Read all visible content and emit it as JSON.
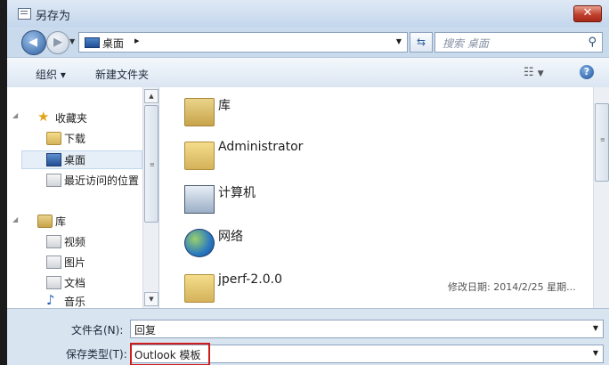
{
  "window": {
    "title": "另存为",
    "close_label": "✕"
  },
  "nav": {
    "address_segment": "桌面",
    "address_separator": "▸",
    "search_placeholder": "搜索 桌面"
  },
  "toolbar": {
    "organize_label": "组织 ▾",
    "new_folder_label": "新建文件夹",
    "help_label": "?"
  },
  "sidebar": {
    "favorites": {
      "label": "收藏夹",
      "icon": "star-icon"
    },
    "favorite_items": [
      {
        "label": "下载",
        "icon": "download-icon"
      },
      {
        "label": "桌面",
        "icon": "desktop-icon"
      },
      {
        "label": "最近访问的位置",
        "icon": "recent-places-icon"
      }
    ],
    "libraries": {
      "label": "库",
      "icon": "library-icon"
    },
    "library_items": [
      {
        "label": "视频",
        "icon": "video-icon"
      },
      {
        "label": "图片",
        "icon": "picture-icon"
      },
      {
        "label": "文档",
        "icon": "document-icon"
      },
      {
        "label": "音乐",
        "icon": "music-icon"
      }
    ]
  },
  "files": [
    {
      "name": "库",
      "meta": "",
      "icon": "library-icon"
    },
    {
      "name": "Administrator",
      "meta": "",
      "icon": "user-folder-icon"
    },
    {
      "name": "计算机",
      "meta": "",
      "icon": "computer-icon"
    },
    {
      "name": "网络",
      "meta": "",
      "icon": "network-icon"
    },
    {
      "name": "jperf-2.0.0",
      "meta": "修改日期: 2014/2/25 星期...",
      "icon": "folder-icon"
    }
  ],
  "form": {
    "filename_label": "文件名(N):",
    "filename_value": "回复",
    "filetype_label": "保存类型(T):",
    "filetype_value": "Outlook 模板"
  },
  "colors": {
    "highlight": "#d01b1b",
    "close": "#c0402c",
    "accent": "#2f5f9f"
  }
}
